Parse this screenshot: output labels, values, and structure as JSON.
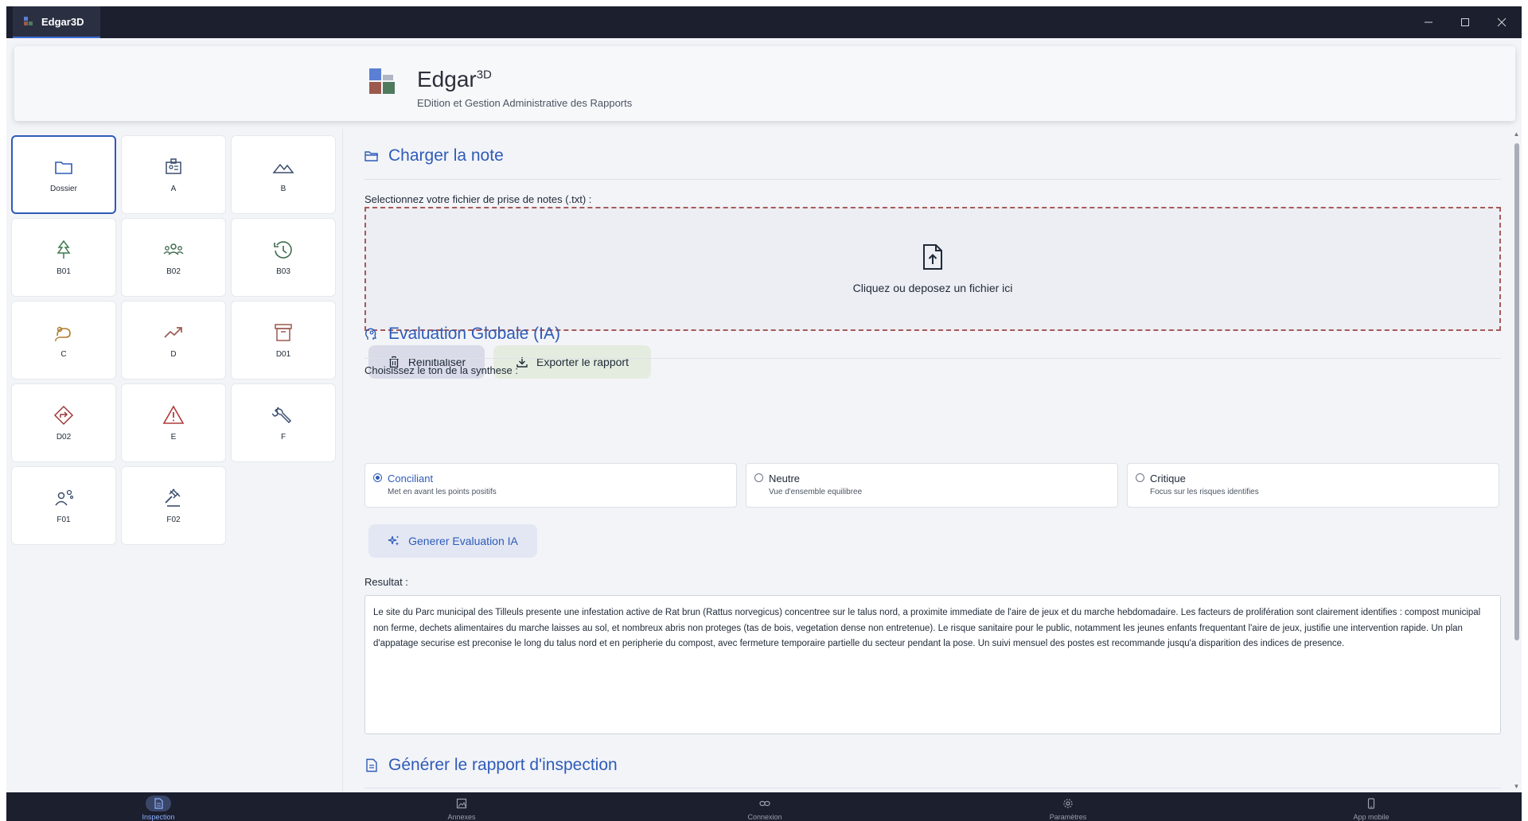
{
  "window": {
    "tab_title": "Edgar3D",
    "controls": [
      "minimize",
      "maximize",
      "close"
    ]
  },
  "header": {
    "app_name": "Edgar",
    "app_name_sup": "3D",
    "subtitle": "EDition et Gestion Administrative des Rapports",
    "logo_colors": [
      "#5b7fd4",
      "#b0b6c4",
      "#9b5a4e",
      "#4f7a5e"
    ]
  },
  "sidebar": {
    "tiles": [
      {
        "label": "Dossier",
        "icon": "folder-icon",
        "color": "#2e5bb8",
        "active": true
      },
      {
        "label": "A",
        "icon": "id-badge-icon",
        "color": "#3b4d6e"
      },
      {
        "label": "B",
        "icon": "mountains-icon",
        "color": "#3b4d6e"
      },
      {
        "label": "B01",
        "icon": "tree-icon",
        "color": "#3f7a4f"
      },
      {
        "label": "B02",
        "icon": "people-group-icon",
        "color": "#3f6a4f"
      },
      {
        "label": "B03",
        "icon": "history-icon",
        "color": "#3f6a4f"
      },
      {
        "label": "C",
        "icon": "rodent-icon",
        "color": "#b07a2a"
      },
      {
        "label": "D",
        "icon": "trend-up-icon",
        "color": "#9b5a4e"
      },
      {
        "label": "D01",
        "icon": "archive-icon",
        "color": "#9b5a4e"
      },
      {
        "label": "D02",
        "icon": "diamond-turn-icon",
        "color": "#9b3a3a"
      },
      {
        "label": "E",
        "icon": "warning-icon",
        "color": "#b03a3a"
      },
      {
        "label": "F",
        "icon": "wrench-icon",
        "color": "#3b4d6e"
      },
      {
        "label": "F01",
        "icon": "worker-gear-icon",
        "color": "#3b4d6e"
      },
      {
        "label": "F02",
        "icon": "gavel-icon",
        "color": "#3b4d6e"
      }
    ]
  },
  "main": {
    "load_note": {
      "title": "Charger la note",
      "file_label": "Selectionnez votre fichier de prise de notes (.txt) :",
      "dropzone_text": "Cliquez ou deposez un fichier ici",
      "reset_label": "Reinitialiser",
      "export_label": "Exporter le rapport"
    },
    "evaluation": {
      "title": "Evaluation Globale (IA)",
      "tone_label": "Choisissez le ton de la synthese :",
      "tones": [
        {
          "title": "Conciliant",
          "desc": "Met en avant les points positifs",
          "selected": true
        },
        {
          "title": "Neutre",
          "desc": "Vue d'ensemble equilibree",
          "selected": false
        },
        {
          "title": "Critique",
          "desc": "Focus sur les risques identifies",
          "selected": false
        }
      ],
      "generate_label": "Generer Evaluation IA",
      "result_label": "Resultat :",
      "result_text": "Le site du Parc municipal des Tilleuls presente une infestation active de Rat brun (Rattus norvegicus) concentree sur le talus nord, a proximite immediate de l'aire de jeux et du marche hebdomadaire. Les facteurs de prolifération sont clairement identifies : compost municipal non ferme, dechets alimentaires du marche laisses au sol, et nombreux abris non proteges (tas de bois, vegetation dense non entretenue). Le risque sanitaire pour le public, notamment les jeunes enfants frequentant l'aire de jeux, justifie une intervention rapide. Un plan d'appatage securise est preconise le long du talus nord et en peripherie du compost, avec fermeture temporaire partielle du secteur pendant la pose. Un suivi mensuel des postes est recommande jusqu'a disparition des indices de presence."
    },
    "report": {
      "title": "Générer le rapport d'inspection"
    }
  },
  "bottom_nav": [
    {
      "label": "Inspection",
      "icon": "document-icon",
      "active": true
    },
    {
      "label": "Annexes",
      "icon": "image-icon",
      "active": false
    },
    {
      "label": "Connexion",
      "icon": "link-icon",
      "active": false
    },
    {
      "label": "Paramètres",
      "icon": "gear-icon",
      "active": false
    },
    {
      "label": "App mobile",
      "icon": "phone-icon",
      "active": false
    }
  ],
  "colors": {
    "accent": "#2e5bb8",
    "dropzone_border": "#a65a5a",
    "titlebar": "#1b1f2e"
  }
}
